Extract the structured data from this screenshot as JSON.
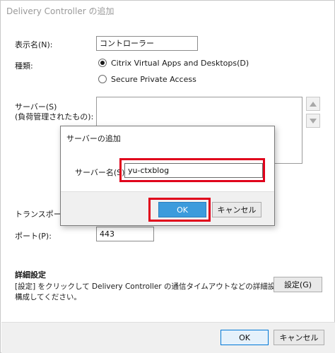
{
  "window": {
    "title": "Delivery Controller の追加"
  },
  "display_name": {
    "label": "表示名(N):",
    "value": "コントローラー"
  },
  "type": {
    "label": "種類:",
    "options": [
      {
        "label": "Citrix Virtual Apps and Desktops(D)",
        "selected": true
      },
      {
        "label": "Secure Private Access",
        "selected": false
      }
    ]
  },
  "servers": {
    "label_line1": "サーバー(S)",
    "label_line2": "(負荷管理されたもの):"
  },
  "transport": {
    "label": "トランスポートの"
  },
  "port": {
    "label": "ポート(P):",
    "value": "443"
  },
  "advanced": {
    "title": "詳細設定",
    "description_line1": "[設定] をクリックして Delivery Controller の通信タイムアウトなどの詳細設定を",
    "description_line2": "構成してください。",
    "settings_button": "設定(G)"
  },
  "footer": {
    "ok": "OK",
    "cancel": "キャンセル"
  },
  "add_server_dialog": {
    "title": "サーバーの追加",
    "server_name_label": "サーバー名(S):",
    "server_name_value": "yu-ctxblog",
    "ok": "OK",
    "cancel": "キャンセル"
  },
  "colors": {
    "highlight": "#e0001b",
    "ok_blue": "#3c9bdc"
  }
}
